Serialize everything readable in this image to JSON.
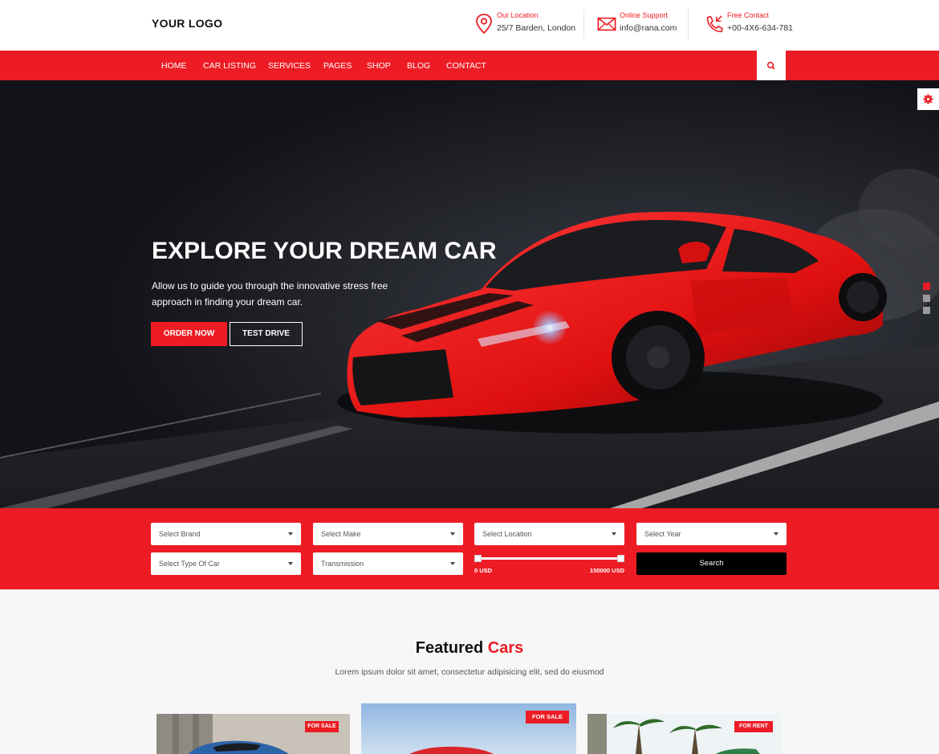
{
  "header": {
    "logo": "YOUR LOGO",
    "contacts": [
      {
        "icon": "map-pin-icon",
        "label": "Our Location",
        "value": "25/7 Barden, London"
      },
      {
        "icon": "envelope-icon",
        "label": "Online Support",
        "value": "info@rana.com"
      },
      {
        "icon": "phone-icon",
        "label": "Free Contact",
        "value": "+00-4X6-634-781"
      }
    ]
  },
  "nav": {
    "items": [
      "HOME",
      "CAR LISTING",
      "SERVICES",
      "PAGES",
      "SHOP",
      "BLOG",
      "CONTACT"
    ]
  },
  "hero": {
    "title": "EXPLORE YOUR DREAM CAR",
    "subtitle": "Allow us to guide you through the innovative stress free approach in finding your dream car.",
    "order_label": "ORDER NOW",
    "test_label": "TEST DRIVE",
    "slides": 3,
    "active_slide": 1
  },
  "filters": {
    "brand": "Select Brand",
    "make": "Select Make",
    "location": "Select Location",
    "year": "Select Year",
    "type": "Select Type Of Car",
    "transmission": "Transmission",
    "price_min": "0 USD",
    "price_max": "150000 USD",
    "search_label": "Search"
  },
  "featured": {
    "title_main": "Featured",
    "title_accent": "Cars",
    "subtitle": "Lorem ipsum dolor sit amet, consectetur adipisicing elit, sed do eiusmod",
    "cards": [
      {
        "badge": "FOR SALE"
      },
      {
        "badge": "FOR SALE"
      },
      {
        "badge": "FOR RENT"
      }
    ]
  },
  "colors": {
    "accent": "#ed1c24",
    "dark": "#121318",
    "black": "#000000",
    "white": "#ffffff"
  }
}
